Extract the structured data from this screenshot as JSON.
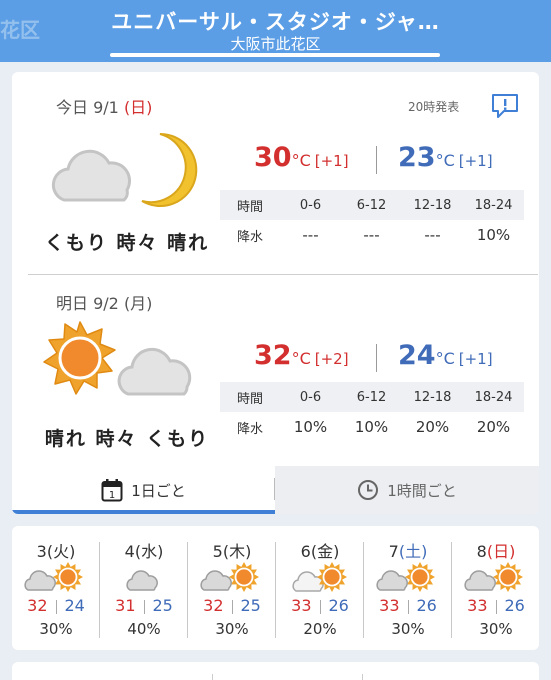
{
  "header": {
    "ghost_text": "花区",
    "title": "ユニバーサル・スタジオ・ジャ…",
    "subtitle": "大阪市此花区"
  },
  "today": {
    "label_prefix": "今日 9/1",
    "label_dow": "(日)",
    "announce": "20時発表",
    "icons": [
      "cloud-icon",
      "moon-icon"
    ],
    "weather_text": "くもり 時々 晴れ",
    "max": "30",
    "max_diff": "[+1]",
    "min": "23",
    "min_diff": "[+1]",
    "unit": "°C",
    "rain_header": [
      "時間",
      "0-6",
      "6-12",
      "12-18",
      "18-24"
    ],
    "rain_label": "降水",
    "rain_values": [
      "---",
      "---",
      "---",
      "10%"
    ]
  },
  "tomorrow": {
    "label_prefix": "明日 9/2",
    "label_dow": "(月)",
    "icons": [
      "sun-icon",
      "cloud-icon"
    ],
    "weather_text": "晴れ 時々 くもり",
    "max": "32",
    "max_diff": "[+2]",
    "min": "24",
    "min_diff": "[+1]",
    "unit": "°C",
    "rain_header": [
      "時間",
      "0-6",
      "6-12",
      "12-18",
      "18-24"
    ],
    "rain_label": "降水",
    "rain_values": [
      "10%",
      "10%",
      "20%",
      "20%"
    ]
  },
  "tabs": {
    "daily": "1日ごと",
    "daily_icon_num": "1",
    "hourly": "1時間ごと"
  },
  "week": [
    {
      "num": "3",
      "dow": "(火)",
      "dow_type": "weekday",
      "icon": "cloud-sun-icon",
      "hi": "32",
      "lo": "24",
      "pop": "30%"
    },
    {
      "num": "4",
      "dow": "(水)",
      "dow_type": "weekday",
      "icon": "cloud-icon",
      "hi": "31",
      "lo": "25",
      "pop": "40%"
    },
    {
      "num": "5",
      "dow": "(木)",
      "dow_type": "weekday",
      "icon": "cloud-sun-icon",
      "hi": "32",
      "lo": "25",
      "pop": "30%"
    },
    {
      "num": "6",
      "dow": "(金)",
      "dow_type": "weekday",
      "icon": "sun-cloud-icon",
      "hi": "33",
      "lo": "26",
      "pop": "20%"
    },
    {
      "num": "7",
      "dow": "(土)",
      "dow_type": "sat",
      "icon": "cloud-sun-icon",
      "hi": "33",
      "lo": "26",
      "pop": "30%"
    },
    {
      "num": "8",
      "dow": "(日)",
      "dow_type": "sun",
      "icon": "cloud-sun-icon",
      "hi": "33",
      "lo": "26",
      "pop": "30%"
    }
  ],
  "colors": {
    "header": "#5b9ee5",
    "max_temp": "#d32f2f",
    "min_temp": "#3f6bb8",
    "tab_active": "#3f80d6",
    "sun": "#f0a32c",
    "moon": "#f2c12e",
    "cloud": "#c8c8c8"
  }
}
